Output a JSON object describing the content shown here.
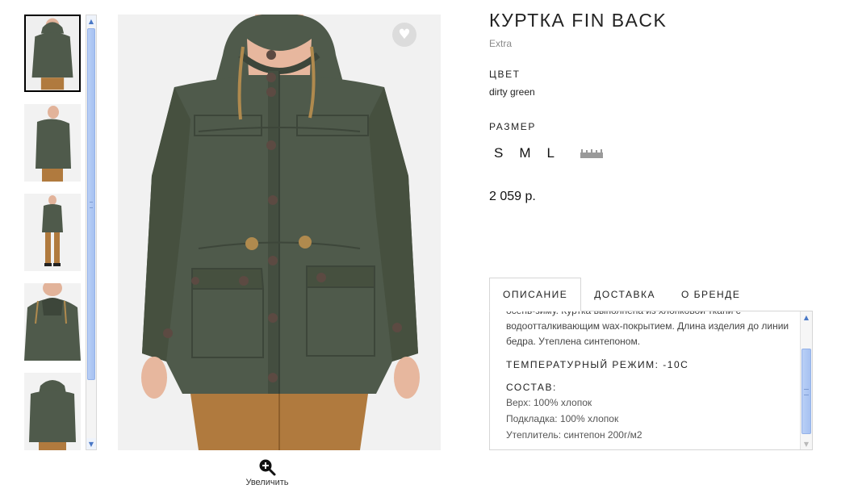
{
  "product": {
    "title": "КУРТКА FIN BACK",
    "brand": "Extra",
    "color_label": "ЦВЕТ",
    "color_value": "dirty green",
    "size_label": "РАЗМЕР",
    "sizes": [
      "S",
      "M",
      "L"
    ],
    "size_chart_icon": "ruler-icon",
    "price": "2 059 р."
  },
  "gallery": {
    "thumb_count": 5,
    "active_thumb": 1,
    "zoom_label": "Увеличить",
    "zoom_icon": "zoom-in-icon",
    "favorite_icon": "heart-icon"
  },
  "tabs": {
    "items": [
      "ОПИСАНИЕ",
      "ДОСТАВКА",
      "О БРЕНДЕ"
    ],
    "active": 0
  },
  "description": {
    "partial_top": "осень-зиму. Куртка выполнена из хлопковой ткани с",
    "text": "водоотталкивающим wax-покрытием. Длина изделия до линии бедра. Утеплена синтепоном.",
    "temp_heading": "ТЕМПЕРАТУРНЫЙ РЕЖИМ: -10С",
    "composition_heading": "СОСТАВ:",
    "composition": [
      "Верх: 100% хлопок",
      "Подкладка: 100% хлопок",
      "Утеплитель: синтепон 200г/м2"
    ]
  },
  "colors": {
    "jacket": "#4f5a4b",
    "jacket_dark": "#3d463a",
    "pants": "#b07a3e",
    "skin": "#e7b79e",
    "scroll_thumb": "#a9c3f2"
  }
}
